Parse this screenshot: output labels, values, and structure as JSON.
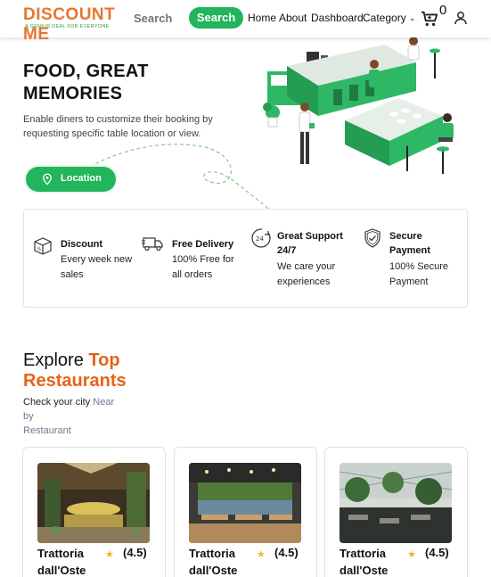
{
  "header": {
    "logo_text_a": "DIS",
    "logo_text_b": "COUNT ME",
    "logo_tagline": "A GENIUS DEAL FOR EVERYONE",
    "search_placeholder": "Search",
    "search_button": "Search",
    "nav": {
      "home": "Home",
      "about": "About",
      "dashboard": "Dashboard",
      "category": "Category"
    },
    "cart_count": "0"
  },
  "hero": {
    "title_line1": "FOOD, GREAT",
    "title_line2": "MEMORIES",
    "description": "Enable diners to customize their booking by requesting specific table location or view.",
    "location_button": "Location"
  },
  "features": [
    {
      "icon": "discount-box-icon",
      "title": "Discount",
      "subtitle": "Every week new sales"
    },
    {
      "icon": "delivery-truck-icon",
      "title": "Free Delivery",
      "subtitle": "100% Free for all orders"
    },
    {
      "icon": "support-24-icon",
      "title": "Great Support 24/7",
      "subtitle": "We care your experiences"
    },
    {
      "icon": "shield-check-icon",
      "title": "Secure Payment",
      "subtitle": "100% Secure Payment"
    }
  ],
  "explore": {
    "prefix": "Explore",
    "highlight_top": "Top",
    "highlight_restaurants": "Restaurants",
    "check_city": "Check your city",
    "near": "Near",
    "by": "by",
    "restaurant": "Restaurant"
  },
  "restaurants": [
    {
      "name": "Trattoria dall'Oste",
      "rating": "(4.5)"
    },
    {
      "name": "Trattoria dall'Oste",
      "rating": "(4.5)"
    },
    {
      "name": "Trattoria dall'Oste",
      "rating": "(4.5)"
    }
  ],
  "colors": {
    "brand_orange": "#e8762d",
    "brand_green": "#22b55b",
    "star": "#f2b51f"
  }
}
